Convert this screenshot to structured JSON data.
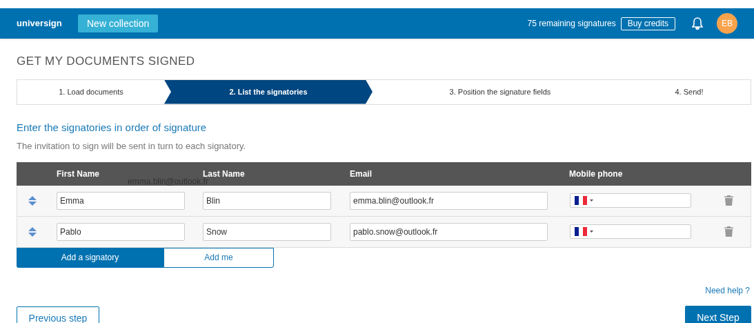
{
  "header": {
    "logo": "universign",
    "new_button": "New collection",
    "remaining": "75 remaining signatures",
    "buy_button": "Buy credits",
    "avatar": "EB"
  },
  "title": "GET MY DOCUMENTS SIGNED",
  "steps": [
    {
      "label": "1. Load documents",
      "selected": false
    },
    {
      "label": "2. List the signatories",
      "selected": true
    },
    {
      "label": "3. Position the signature fields",
      "selected": false
    },
    {
      "label": "4. Send!",
      "selected": false
    }
  ],
  "heading": "Enter the signatories in order of signature",
  "subheading": "The invitation to sign will be sent in turn to each signatory.",
  "table": {
    "columns": [
      "First Name",
      "Last Name",
      "Email",
      "Mobile phone"
    ],
    "autocomplete_hint": "emma.blin@outlook.fr",
    "rows": [
      {
        "first_name": "Emma",
        "last_name": "Blin",
        "email": "emma.blin@outlook.fr"
      },
      {
        "first_name": "Pablo",
        "last_name": "Snow",
        "email": "pablo.snow@outlook.fr"
      }
    ]
  },
  "add_buttons": [
    {
      "label": "Add a signatory",
      "kind": "primary"
    },
    {
      "label": "Add me",
      "kind": "outline"
    }
  ],
  "help_link": "Need help ?",
  "previous_button": "Previous step",
  "next_button": "Next Step"
}
